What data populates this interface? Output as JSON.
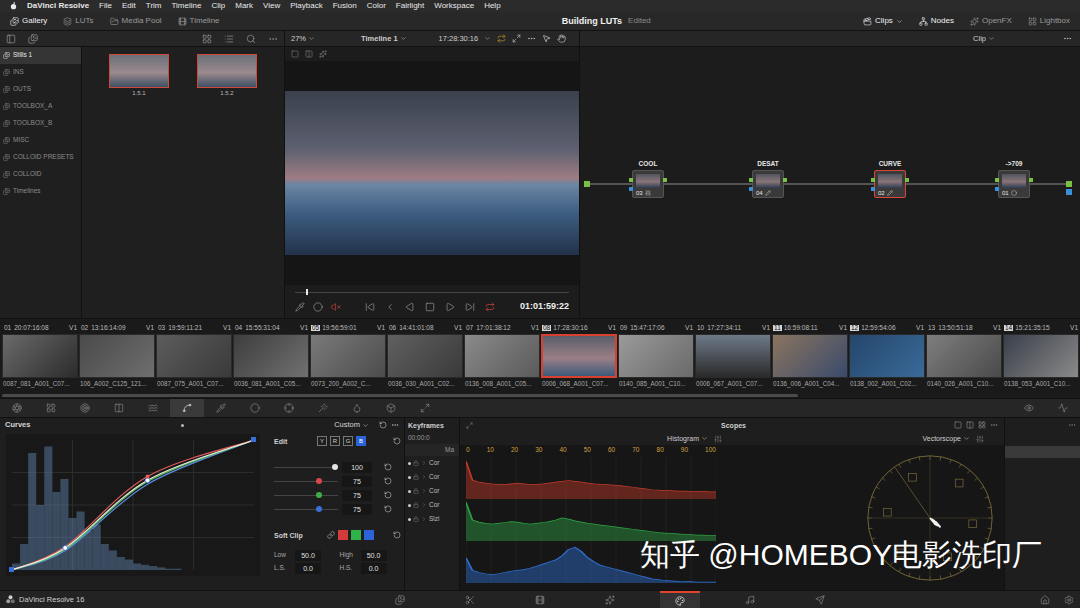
{
  "menu_bar": {
    "app": "DaVinci Resolve",
    "items": [
      "File",
      "Edit",
      "Trim",
      "Timeline",
      "Clip",
      "Mark",
      "View",
      "Playback",
      "Fusion",
      "Color",
      "Fairlight",
      "Workspace",
      "Help"
    ]
  },
  "toolbar": {
    "left": [
      {
        "label": "Gallery",
        "selected": true,
        "kind": "gallery"
      },
      {
        "label": "LUTs",
        "selected": false,
        "kind": "luts"
      },
      {
        "label": "Media Pool",
        "selected": false,
        "kind": "media-pool"
      },
      {
        "label": "Timeline",
        "selected": false,
        "kind": "timeline"
      }
    ],
    "project": "Building LUTs",
    "status": "Edited",
    "right": [
      {
        "label": "Clips",
        "selected": true,
        "kind": "clips"
      },
      {
        "label": "Nodes",
        "selected": true,
        "kind": "nodes"
      },
      {
        "label": "OpenFX",
        "selected": false,
        "kind": "openfx"
      },
      {
        "label": "Lightbox",
        "selected": false,
        "kind": "lightbox"
      }
    ]
  },
  "gallery": {
    "albums": [
      {
        "label": "Stills 1",
        "selected": true
      },
      {
        "label": "INS",
        "selected": false
      },
      {
        "label": "OUTS",
        "selected": false
      },
      {
        "label": "TOOLBOX_A",
        "selected": false
      },
      {
        "label": "TOOLBOX_B",
        "selected": false
      },
      {
        "label": "MISC",
        "selected": false
      },
      {
        "label": "COLLOID PRESETS",
        "selected": false
      },
      {
        "label": "COLLOID",
        "selected": false
      },
      {
        "label": "Timelines",
        "selected": false
      }
    ],
    "stills": [
      {
        "label": "1.5.1"
      },
      {
        "label": "1.5.2"
      }
    ]
  },
  "viewer": {
    "zoom": "27%",
    "timeline": "Timeline 1",
    "timecode": "17:28:30:16",
    "playhead": 0.04,
    "clip_timecode": "01:01:59:22"
  },
  "node_editor": {
    "mode": "Clip",
    "nodes": [
      {
        "label": "COOL",
        "number": "03",
        "selected": false,
        "kind": "bars"
      },
      {
        "label": "DESAT",
        "number": "04",
        "selected": false,
        "kind": "pencil"
      },
      {
        "label": "CURVE",
        "number": "02",
        "selected": true,
        "kind": "pencil"
      },
      {
        "label": "->709",
        "number": "01",
        "selected": false,
        "kind": "circle"
      }
    ]
  },
  "clips": [
    {
      "number": "01",
      "timecode": "20:07:16:08",
      "track": "V1",
      "name": "0087_081_A001_C07...",
      "marked": false,
      "selected": false
    },
    {
      "number": "02",
      "timecode": "13:16:14:09",
      "track": "V1",
      "name": "106_A002_C125_121...",
      "marked": false,
      "selected": false
    },
    {
      "number": "03",
      "timecode": "19:59:11:21",
      "track": "V1",
      "name": "0087_075_A001_C07...",
      "marked": false,
      "selected": false
    },
    {
      "number": "04",
      "timecode": "15:55:31:04",
      "track": "V1",
      "name": "0036_081_A001_C05...",
      "marked": false,
      "selected": false
    },
    {
      "number": "05",
      "timecode": "19:56:59:01",
      "track": "V1",
      "name": "0073_200_A002_C...",
      "marked": true,
      "selected": false
    },
    {
      "number": "06",
      "timecode": "14:41:01:08",
      "track": "V1",
      "name": "0036_030_A001_C02...",
      "marked": false,
      "selected": false
    },
    {
      "number": "07",
      "timecode": "17:01:38:12",
      "track": "V1",
      "name": "0136_008_A001_C05...",
      "marked": false,
      "selected": false
    },
    {
      "number": "08",
      "timecode": "17:28:30:16",
      "track": "V1",
      "name": "0006_068_A001_C07...",
      "marked": true,
      "selected": true
    },
    {
      "number": "09",
      "timecode": "15:47:17:06",
      "track": "V1",
      "name": "0140_085_A001_C10...",
      "marked": false,
      "selected": false
    },
    {
      "number": "10",
      "timecode": "17:27:34:11",
      "track": "V1",
      "name": "0006_067_A001_C07...",
      "marked": false,
      "selected": false
    },
    {
      "number": "11",
      "timecode": "16:59:08:11",
      "track": "V1",
      "name": "0136_006_A001_C04...",
      "marked": true,
      "selected": false
    },
    {
      "number": "12",
      "timecode": "12:59:54:06",
      "track": "V1",
      "name": "0138_002_A001_C02...",
      "marked": true,
      "selected": false
    },
    {
      "number": "13",
      "timecode": "13:50:51:18",
      "track": "V1",
      "name": "0140_026_A001_C10...",
      "marked": false,
      "selected": false
    },
    {
      "number": "14",
      "timecode": "15:21:35:15",
      "track": "V1",
      "name": "0138_053_A001_C10...",
      "marked": true,
      "selected": false
    }
  ],
  "timeline_scroll": {
    "level": 0.74
  },
  "palette_left": [
    {
      "kind": "camera-raw",
      "selected": false
    },
    {
      "kind": "color-match",
      "selected": false
    },
    {
      "kind": "primaries",
      "selected": false
    },
    {
      "kind": "rgb-mixer",
      "selected": false
    },
    {
      "kind": "motion-effects",
      "selected": false
    },
    {
      "kind": "curves",
      "selected": true
    },
    {
      "kind": "qualifier",
      "selected": false
    },
    {
      "kind": "window",
      "selected": false
    },
    {
      "kind": "tracker",
      "selected": false
    },
    {
      "kind": "magic",
      "selected": false
    },
    {
      "kind": "blur",
      "selected": false
    },
    {
      "kind": "key",
      "selected": false
    },
    {
      "kind": "sizing",
      "selected": false
    }
  ],
  "palette_right": [
    {
      "kind": "scopes-view",
      "selected": false
    },
    {
      "kind": "info",
      "selected": false
    }
  ],
  "curves": {
    "title": "Curves",
    "mode": "Custom",
    "histogram": [
      0.05,
      0.2,
      0.9,
      0.5,
      0.95,
      0.6,
      0.7,
      0.4,
      0.45,
      0.3,
      0.35,
      0.2,
      0.15,
      0.1,
      0.08,
      0.05,
      0.04,
      0.03,
      0.02,
      0.01,
      0.01,
      0,
      0,
      0,
      0,
      0,
      0,
      0,
      0,
      0
    ],
    "series": [
      {
        "channel": "B",
        "color": "#5b8de0",
        "points": [
          [
            0,
            0
          ],
          [
            0.22,
            0.15
          ],
          [
            0.56,
            0.66
          ],
          [
            1,
            1
          ]
        ]
      },
      {
        "channel": "G",
        "color": "#58c060",
        "points": [
          [
            0,
            0
          ],
          [
            0.22,
            0.16
          ],
          [
            0.56,
            0.68
          ],
          [
            1,
            1
          ]
        ]
      },
      {
        "channel": "R",
        "color": "#e05a5a",
        "points": [
          [
            0,
            0
          ],
          [
            0.22,
            0.18
          ],
          [
            0.56,
            0.72
          ],
          [
            1,
            1
          ]
        ]
      },
      {
        "channel": "Y",
        "color": "#f0f0e0",
        "points": [
          [
            0,
            0
          ],
          [
            0.22,
            0.17
          ],
          [
            0.56,
            0.69
          ],
          [
            1,
            1
          ]
        ]
      }
    ]
  },
  "edit": {
    "title": "Edit",
    "channels": [
      {
        "label": "Y",
        "selected": false
      },
      {
        "label": "R",
        "selected": false
      },
      {
        "label": "G",
        "selected": false
      },
      {
        "label": "B",
        "selected": true
      }
    ],
    "intensity": [
      {
        "value": "100",
        "level": 1,
        "color": "#e6e6e6"
      },
      {
        "value": "75",
        "level": 0.75,
        "color": "#d94848"
      },
      {
        "value": "75",
        "level": 0.75,
        "color": "#3fae4a"
      },
      {
        "value": "75",
        "level": 0.75,
        "color": "#3a6fd8"
      }
    ],
    "soft_clip": {
      "title": "Soft Clip",
      "swatches": [
        {
          "color": "#d33a3a"
        },
        {
          "color": "#2fb24a"
        },
        {
          "color": "#2d63d8"
        }
      ],
      "fields": [
        {
          "label": "Low",
          "value": "50.0"
        },
        {
          "label": "High",
          "value": "50.0"
        },
        {
          "label": "L.S.",
          "value": "0.0"
        },
        {
          "label": "H.S.",
          "value": "0.0"
        }
      ]
    }
  },
  "keyframes": {
    "title": "Keyframes",
    "timecode": "00:00:0",
    "master": "Ma",
    "rows": [
      "Cor",
      "Cor",
      "Cor",
      "Cor",
      "Sizi"
    ]
  },
  "scopes": {
    "title": "Scopes",
    "left_scope": "Histogram",
    "right_scope": "Vectorscope",
    "ticks": [
      "0",
      "10",
      "20",
      "30",
      "40",
      "50",
      "60",
      "70",
      "80",
      "90",
      "100"
    ],
    "histogram": [
      {
        "channel": "R",
        "color": "#c0392b",
        "values": [
          90,
          45,
          40,
          38,
          36,
          35,
          34,
          36,
          38,
          36,
          34,
          35,
          36,
          38,
          40,
          42,
          44,
          42,
          40,
          38,
          36,
          35,
          34,
          33,
          32,
          30,
          28,
          26,
          24,
          22,
          21,
          20,
          20,
          19,
          19,
          18,
          18,
          18,
          17,
          17
        ]
      },
      {
        "channel": "G",
        "color": "#2ea043",
        "values": [
          92,
          50,
          45,
          42,
          40,
          42,
          44,
          46,
          45,
          42,
          40,
          42,
          44,
          46,
          50,
          55,
          52,
          48,
          45,
          42,
          40,
          38,
          36,
          34,
          32,
          30,
          28,
          26,
          24,
          22,
          20,
          19,
          18,
          17,
          16,
          15,
          14,
          14,
          13,
          13
        ]
      },
      {
        "channel": "B",
        "color": "#2f6fd0",
        "values": [
          60,
          30,
          25,
          22,
          20,
          22,
          25,
          28,
          30,
          32,
          35,
          40,
          45,
          50,
          55,
          65,
          80,
          85,
          75,
          60,
          50,
          42,
          38,
          34,
          30,
          26,
          22,
          18,
          14,
          10,
          8,
          6,
          5,
          4,
          3,
          3,
          2,
          2,
          2,
          2
        ]
      }
    ],
    "vectorscope_trace": [
      [
        0,
        0
      ],
      [
        0.05,
        0.06
      ],
      [
        0.12,
        0.12
      ],
      [
        0.08,
        0.1
      ],
      [
        0.03,
        0.02
      ],
      [
        0.1,
        0.07
      ],
      [
        0.16,
        0.14
      ],
      [
        0.06,
        0.04
      ]
    ]
  },
  "page_bar": {
    "app": "DaVinci Resolve 16",
    "pages": [
      {
        "kind": "media",
        "selected": false
      },
      {
        "kind": "cut",
        "selected": false
      },
      {
        "kind": "edit",
        "selected": false
      },
      {
        "kind": "fusion",
        "selected": false
      },
      {
        "kind": "color",
        "selected": true
      },
      {
        "kind": "fairlight",
        "selected": false
      },
      {
        "kind": "deliver",
        "selected": false
      }
    ]
  },
  "watermark": "知乎 @HOMEBOY电影洗印厂"
}
